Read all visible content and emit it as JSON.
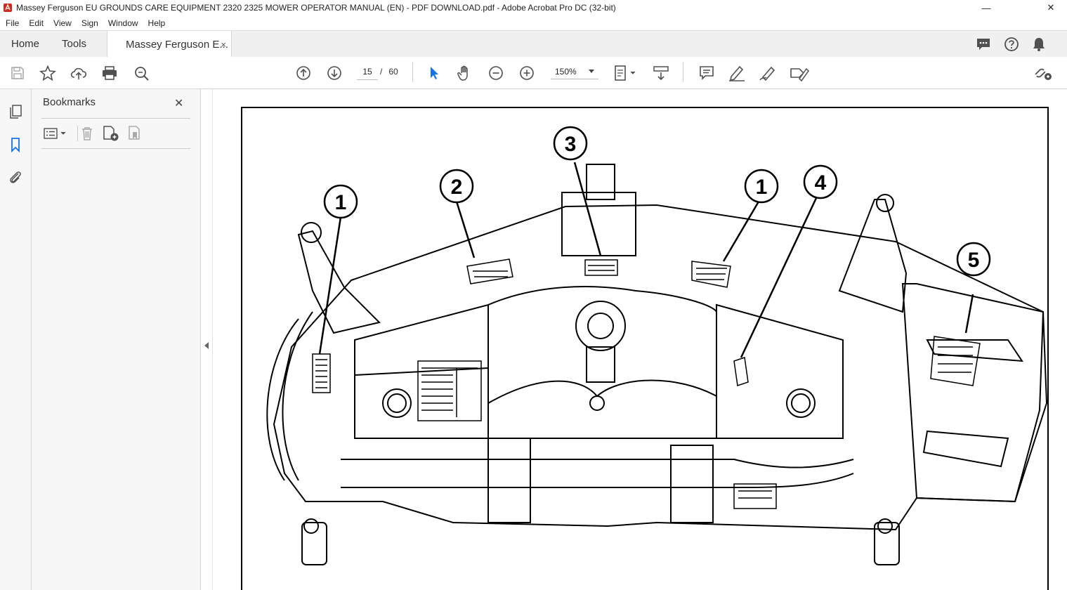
{
  "window": {
    "title": "Massey Ferguson EU GROUNDS CARE EQUIPMENT 2320  2325 MOWER OPERATOR MANUAL (EN) - PDF DOWNLOAD.pdf - Adobe Acrobat Pro DC (32-bit)",
    "minimize": "—",
    "maximize": "☐",
    "close": "✕"
  },
  "menu": [
    "File",
    "Edit",
    "View",
    "Sign",
    "Window",
    "Help"
  ],
  "tabs": {
    "home": "Home",
    "tools": "Tools",
    "doc": "Massey Ferguson E...",
    "doc_close": "×"
  },
  "toolbar": {
    "page_current": "15",
    "page_sep": "/",
    "page_total": "60",
    "zoom": "150%"
  },
  "bookmarks": {
    "title": "Bookmarks",
    "close": "✕"
  },
  "figure": {
    "callouts": [
      "1",
      "2",
      "3",
      "1",
      "4",
      "5"
    ]
  },
  "colors": {
    "acrobat_red": "#d32a1f",
    "select_blue": "#1473e6",
    "icon_gray": "#505050"
  }
}
